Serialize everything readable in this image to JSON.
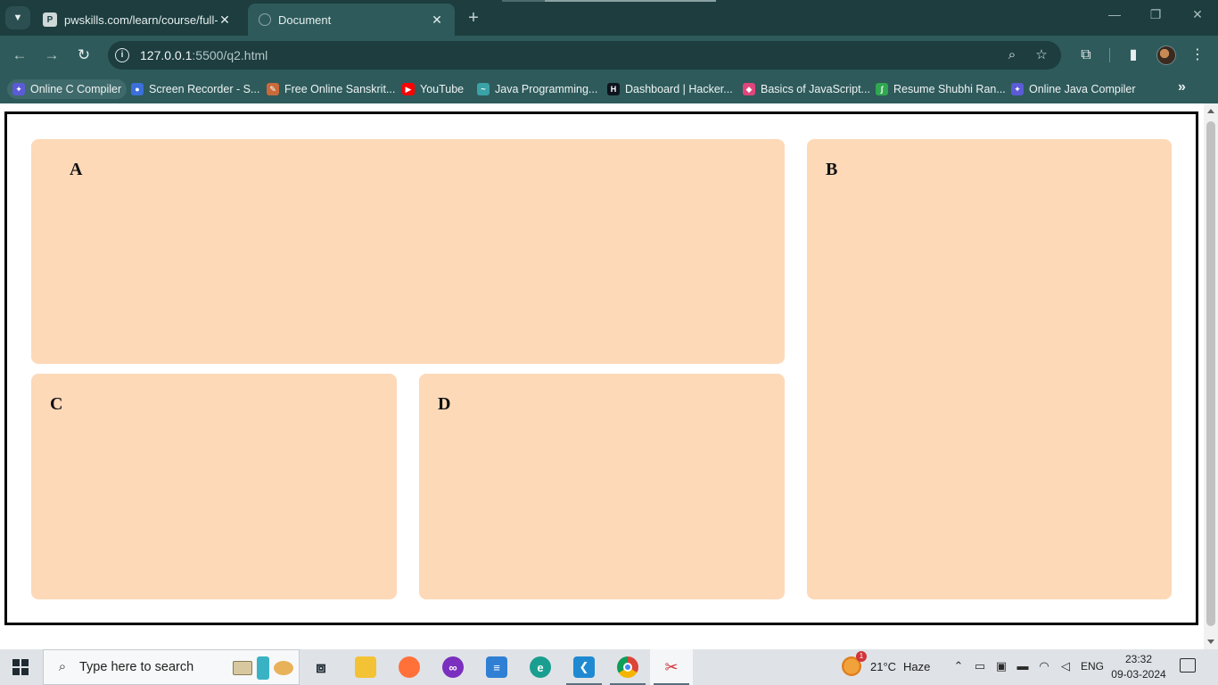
{
  "browser": {
    "tabs": [
      {
        "title": "pwskills.com/learn/course/full-s",
        "active": false
      },
      {
        "title": "Document",
        "active": true
      }
    ],
    "new_tab_symbol": "+",
    "address": {
      "host": "127.0.0.1",
      "path": ":5500/q2.html"
    },
    "bookmarks": [
      {
        "label": "Online C Compiler",
        "icon_color": "#5b5bd6"
      },
      {
        "label": "Screen Recorder - S...",
        "icon_color": "#3b6fd9"
      },
      {
        "label": "Free Online Sanskrit...",
        "icon_color": "#c86a3a"
      },
      {
        "label": "YouTube",
        "icon_color": "#ff0000"
      },
      {
        "label": "Java Programming...",
        "icon_color": "#3aa3a8"
      },
      {
        "label": "Dashboard | Hacker...",
        "icon_color": "#0e141e"
      },
      {
        "label": "Basics of JavaScript...",
        "icon_color": "#e0457b"
      },
      {
        "label": "Resume Shubhi Ran...",
        "icon_color": "#2fa84f"
      },
      {
        "label": "Online Java Compiler",
        "icon_color": "#5b5bd6"
      }
    ],
    "bookmarks_overflow": "»"
  },
  "page": {
    "box_color": "#fdd9b8",
    "boxes": {
      "a": "A",
      "b": "B",
      "c": "C",
      "d": "D"
    }
  },
  "taskbar": {
    "search_placeholder": "Type here to search",
    "weather": {
      "temp": "21°C",
      "condition": "Haze",
      "alert_count": "1"
    },
    "language": "ENG",
    "time": "23:32",
    "date": "09-03-2024",
    "apps": [
      "task-view",
      "file-explorer",
      "firefox",
      "games",
      "notepad",
      "edge",
      "vscode",
      "chrome",
      "snipping-tool"
    ]
  }
}
